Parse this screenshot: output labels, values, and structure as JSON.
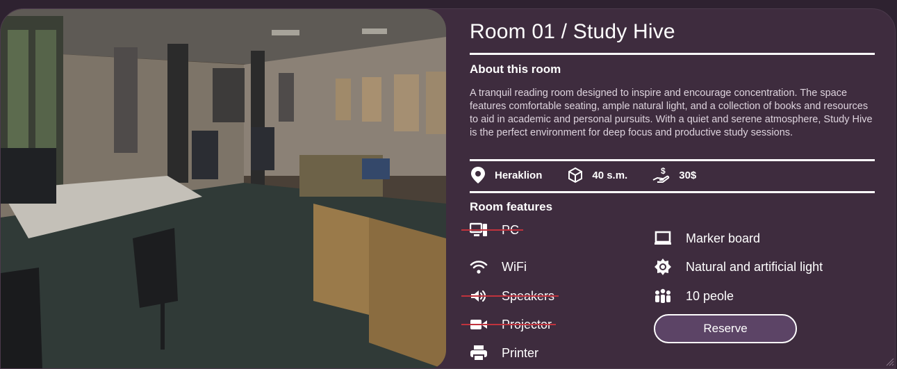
{
  "room": {
    "title": "Room 01 / Study Hive",
    "about_heading": "About this room",
    "description": "A tranquil reading room designed to inspire and encourage concentration. The space features comfortable seating, ample natural light, and a collection of books and resources to aid in academic and personal pursuits. With a quiet and serene atmosphere, Study Hive is the perfect environment for deep focus and productive study sessions."
  },
  "meta": {
    "location": "Heraklion",
    "area": "40 s.m.",
    "price": "30$"
  },
  "features": {
    "heading": "Room features",
    "left": [
      {
        "label": "PC",
        "icon": "pc-icon",
        "available": false
      },
      {
        "label": "WiFi",
        "icon": "wifi-icon",
        "available": true
      },
      {
        "label": "Speakers",
        "icon": "speaker-icon",
        "available": false
      },
      {
        "label": "Projector",
        "icon": "projector-icon",
        "available": false
      },
      {
        "label": "Printer",
        "icon": "printer-icon",
        "available": true
      }
    ],
    "right": [
      {
        "label": "Marker board",
        "icon": "marker-board-icon",
        "available": true
      },
      {
        "label": "Natural and artificial light",
        "icon": "light-icon",
        "available": true
      },
      {
        "label": "10 peole",
        "icon": "people-icon",
        "available": true
      }
    ]
  },
  "actions": {
    "reserve_label": "Reserve"
  },
  "colors": {
    "background": "#2e2230",
    "card": "#3e2c3e",
    "button": "#5c4466",
    "strike": "#c0333d"
  }
}
